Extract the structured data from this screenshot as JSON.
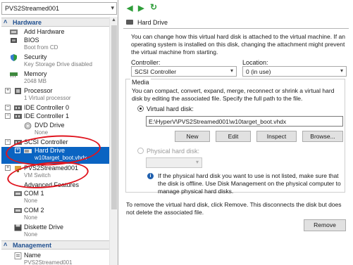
{
  "vm_selector": {
    "value": "PVS2Streamed001"
  },
  "toolbar": {
    "back_icon": "arrow-left-icon",
    "forward_icon": "arrow-right-icon",
    "refresh_icon": "refresh-icon"
  },
  "sidebar": {
    "hardware_header": "Hardware",
    "management_header": "Management",
    "items": [
      {
        "label": "Add Hardware",
        "sub": ""
      },
      {
        "label": "BIOS",
        "sub": "Boot from CD"
      },
      {
        "label": "Security",
        "sub": "Key Storage Drive disabled"
      },
      {
        "label": "Memory",
        "sub": "2048 MB"
      },
      {
        "label": "Processor",
        "sub": "1 Virtual processor"
      },
      {
        "label": "IDE Controller 0",
        "sub": ""
      },
      {
        "label": "IDE Controller 1",
        "sub": ""
      },
      {
        "label": "DVD Drive",
        "sub": "None"
      },
      {
        "label": "SCSI Controller",
        "sub": ""
      },
      {
        "label": "Hard Drive",
        "sub": "w10target_boot.vhdx"
      },
      {
        "label": "PVS2Streamed001",
        "sub": "VM Switch"
      },
      {
        "label": "Advanced Features",
        "sub": ""
      },
      {
        "label": "COM 1",
        "sub": "None"
      },
      {
        "label": "COM 2",
        "sub": "None"
      },
      {
        "label": "Diskette Drive",
        "sub": "None"
      },
      {
        "label": "Name",
        "sub": "PVS2Streamed001"
      }
    ]
  },
  "panel": {
    "title": "Hard Drive",
    "intro": "You can change how this virtual hard disk is attached to the virtual machine. If an operating system is installed on this disk, changing the attachment might prevent the virtual machine from starting.",
    "controller_label": "Controller:",
    "controller_value": "SCSI Controller",
    "location_label": "Location:",
    "location_value": "0 (in use)",
    "media_legend": "Media",
    "media_desc": "You can compact, convert, expand, merge, reconnect or shrink a virtual hard disk by editing the associated file. Specify the full path to the file.",
    "vhd_radio_label": "Virtual hard disk:",
    "vhd_path": "E:\\HyperV\\PVS2Streamed001\\w10target_boot.vhdx",
    "buttons": {
      "new": "New",
      "edit": "Edit",
      "inspect": "Inspect",
      "browse": "Browse..."
    },
    "physical_radio_label": "Physical hard disk:",
    "physical_info": "If the physical hard disk you want to use is not listed, make sure that the disk is offline. Use Disk Management on the physical computer to manage physical hard disks.",
    "remove_desc": "To remove the virtual hard disk, click Remove. This disconnects the disk but does not delete the associated file.",
    "remove_button": "Remove"
  },
  "colors": {
    "selection": "#0a64c2",
    "header_text": "#1f4f8f",
    "annotation": "#e0141e",
    "nav_green": "#2f9e3a"
  }
}
